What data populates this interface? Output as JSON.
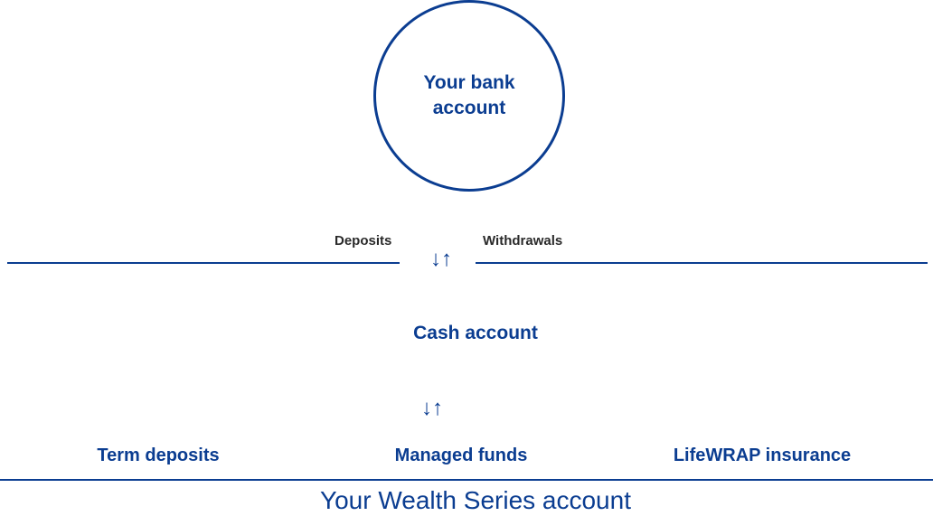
{
  "bank": {
    "label": "Your bank account"
  },
  "flow": {
    "deposits_label": "Deposits",
    "withdrawals_label": "Withdrawals",
    "arrows_glyph": "↓↑"
  },
  "cash": {
    "label": "Cash account"
  },
  "products": [
    {
      "label": "Term deposits"
    },
    {
      "label": "Managed funds"
    },
    {
      "label": "LifeWRAP insurance"
    }
  ],
  "wealth": {
    "label": "Your Wealth Series account"
  },
  "colors": {
    "brand_blue": "#0b3d91",
    "label_dark": "#2a2a2a"
  }
}
